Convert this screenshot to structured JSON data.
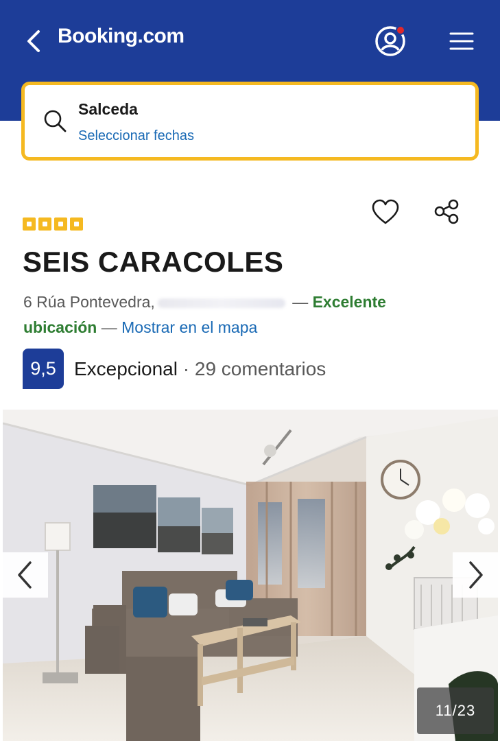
{
  "header": {
    "brand": "Booking.com",
    "back_icon": "chevron-left-icon",
    "profile_icon": "user-profile-icon",
    "menu_icon": "hamburger-menu-icon",
    "color": "#1d3d98"
  },
  "search": {
    "destination": "Salceda",
    "dates_prompt": "Seleccionar fechas",
    "icon": "search-icon",
    "border_color": "#f5b921"
  },
  "property": {
    "star_count": 4,
    "name": "SEIS CARACOLES",
    "address": "6 Rúa Pontevedra,",
    "location_dash": "—",
    "location_label": "Excelente ubicación",
    "map_dash": "—",
    "map_link": "Mostrar en el mapa"
  },
  "rating": {
    "score": "9,5",
    "label": "Excepcional",
    "separator": "·",
    "reviews": "29 comentarios"
  },
  "gallery": {
    "counter": "11/23",
    "prev_icon": "chevron-left-icon",
    "next_icon": "chevron-right-icon"
  },
  "colors": {
    "brand_blue": "#1d3d98",
    "accent_yellow": "#f5b921",
    "link_blue": "#1a6ab5",
    "good_green": "#2e7d32"
  }
}
